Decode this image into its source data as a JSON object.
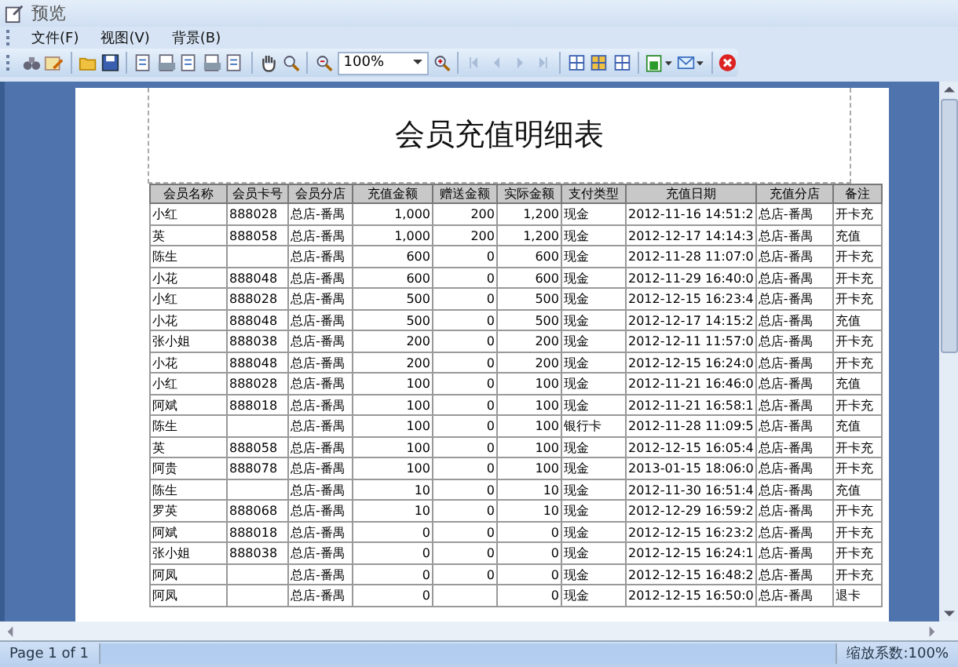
{
  "window": {
    "title": "预览"
  },
  "menu": [
    {
      "label": "文件(F)"
    },
    {
      "label": "视图(V)"
    },
    {
      "label": "背景(B)"
    }
  ],
  "toolbar": {
    "zoom": "100%"
  },
  "report": {
    "title": "会员充值明细表",
    "columns": [
      "会员名称",
      "会员卡号",
      "会员分店",
      "充值金额",
      "赠送金额",
      "实际金额",
      "支付类型",
      "充值日期",
      "充值分店",
      "备注"
    ],
    "rows": [
      [
        "小红",
        "888028",
        "总店-番禺",
        "1,000",
        "200",
        "1,200",
        "现金",
        "2012-11-16 14:51:2",
        "总店-番禺",
        "开卡充"
      ],
      [
        "英",
        "888058",
        "总店-番禺",
        "1,000",
        "200",
        "1,200",
        "现金",
        "2012-12-17 14:14:3",
        "总店-番禺",
        "充值"
      ],
      [
        "陈生",
        "",
        "总店-番禺",
        "600",
        "0",
        "600",
        "现金",
        "2012-11-28 11:07:0",
        "总店-番禺",
        "开卡充"
      ],
      [
        "小花",
        "888048",
        "总店-番禺",
        "600",
        "0",
        "600",
        "现金",
        "2012-11-29 16:40:0",
        "总店-番禺",
        "开卡充"
      ],
      [
        "小红",
        "888028",
        "总店-番禺",
        "500",
        "0",
        "500",
        "现金",
        "2012-12-15 16:23:4",
        "总店-番禺",
        "开卡充"
      ],
      [
        "小花",
        "888048",
        "总店-番禺",
        "500",
        "0",
        "500",
        "现金",
        "2012-12-17 14:15:2",
        "总店-番禺",
        "充值"
      ],
      [
        "张小姐",
        "888038",
        "总店-番禺",
        "200",
        "0",
        "200",
        "现金",
        "2012-12-11 11:57:0",
        "总店-番禺",
        "开卡充"
      ],
      [
        "小花",
        "888048",
        "总店-番禺",
        "200",
        "0",
        "200",
        "现金",
        "2012-12-15 16:24:0",
        "总店-番禺",
        "开卡充"
      ],
      [
        "小红",
        "888028",
        "总店-番禺",
        "100",
        "0",
        "100",
        "现金",
        "2012-11-21 16:46:0",
        "总店-番禺",
        "充值"
      ],
      [
        "阿斌",
        "888018",
        "总店-番禺",
        "100",
        "0",
        "100",
        "现金",
        "2012-11-21 16:58:1",
        "总店-番禺",
        "开卡充"
      ],
      [
        "陈生",
        "",
        "总店-番禺",
        "100",
        "0",
        "100",
        "银行卡",
        "2012-11-28 11:09:5",
        "总店-番禺",
        "充值"
      ],
      [
        "英",
        "888058",
        "总店-番禺",
        "100",
        "0",
        "100",
        "现金",
        "2012-12-15 16:05:4",
        "总店-番禺",
        "开卡充"
      ],
      [
        "阿贵",
        "888078",
        "总店-番禺",
        "100",
        "0",
        "100",
        "现金",
        "2013-01-15 18:06:0",
        "总店-番禺",
        "开卡充"
      ],
      [
        "陈生",
        "",
        "总店-番禺",
        "10",
        "0",
        "10",
        "现金",
        "2012-11-30 16:51:4",
        "总店-番禺",
        "充值"
      ],
      [
        "罗英",
        "888068",
        "总店-番禺",
        "10",
        "0",
        "10",
        "现金",
        "2012-12-29 16:59:2",
        "总店-番禺",
        "开卡充"
      ],
      [
        "阿斌",
        "888018",
        "总店-番禺",
        "0",
        "0",
        "0",
        "现金",
        "2012-12-15 16:23:2",
        "总店-番禺",
        "开卡充"
      ],
      [
        "张小姐",
        "888038",
        "总店-番禺",
        "0",
        "0",
        "0",
        "现金",
        "2012-12-15 16:24:1",
        "总店-番禺",
        "开卡充"
      ],
      [
        "阿凤",
        "",
        "总店-番禺",
        "0",
        "0",
        "0",
        "现金",
        "2012-12-15 16:48:2",
        "总店-番禺",
        "开卡充"
      ],
      [
        "阿凤",
        "",
        "总店-番禺",
        "0",
        "",
        "0",
        "现金",
        "2012-12-15 16:50:0",
        "总店-番禺",
        "退卡"
      ]
    ]
  },
  "status_bar": {
    "page": "Page 1 of 1",
    "zoom": "缩放系数:100%"
  }
}
